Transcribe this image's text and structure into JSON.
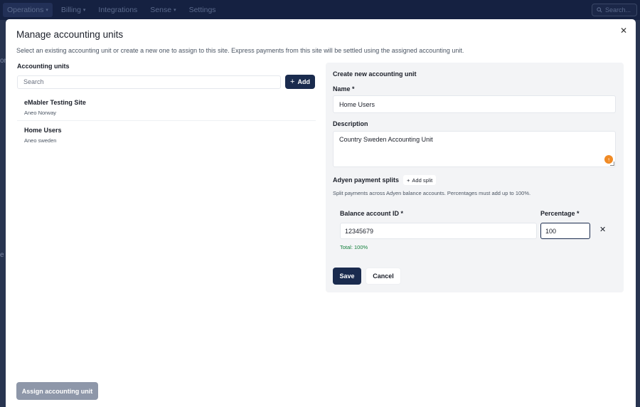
{
  "nav": {
    "items": [
      {
        "label": "Operations",
        "caret": true
      },
      {
        "label": "Billing",
        "caret": true
      },
      {
        "label": "Integrations",
        "caret": false
      },
      {
        "label": "Sense",
        "caret": true
      },
      {
        "label": "Settings",
        "caret": false
      }
    ],
    "search_label": "Search..."
  },
  "background": {
    "glyph1": "on",
    "glyph2": "e"
  },
  "modal": {
    "title": "Manage accounting units",
    "description": "Select an existing accounting unit or create a new one to assign to this site. Express payments from this site will be settled using the assigned accounting unit.",
    "close_icon": "close-icon"
  },
  "left": {
    "section_label": "Accounting units",
    "search_placeholder": "Search",
    "add_label": "Add",
    "units": [
      {
        "name": "eMabler Testing Site",
        "sub": "Aneo Norway"
      },
      {
        "name": "Home Users",
        "sub": "Aneo sweden"
      }
    ]
  },
  "form": {
    "title": "Create new accounting unit",
    "name_label": "Name *",
    "name_value": "Home Users",
    "description_label": "Description",
    "description_value": "Country Sweden Accounting Unit",
    "splits_label": "Adyen payment splits",
    "add_split_label": "Add split",
    "splits_help": "Split payments across Adyen balance accounts. Percentages must add up to 100%.",
    "balance_account_label": "Balance account ID *",
    "percentage_label": "Percentage *",
    "balance_account_value": "12345679",
    "percentage_value": "100",
    "total_text": "Total: 100%",
    "save_label": "Save",
    "cancel_label": "Cancel"
  },
  "footer": {
    "assign_label": "Assign accounting unit"
  },
  "colors": {
    "primary": "#1a2b4e",
    "success": "#15803d",
    "accent": "#f08a24",
    "disabled": "#8e97a9"
  }
}
